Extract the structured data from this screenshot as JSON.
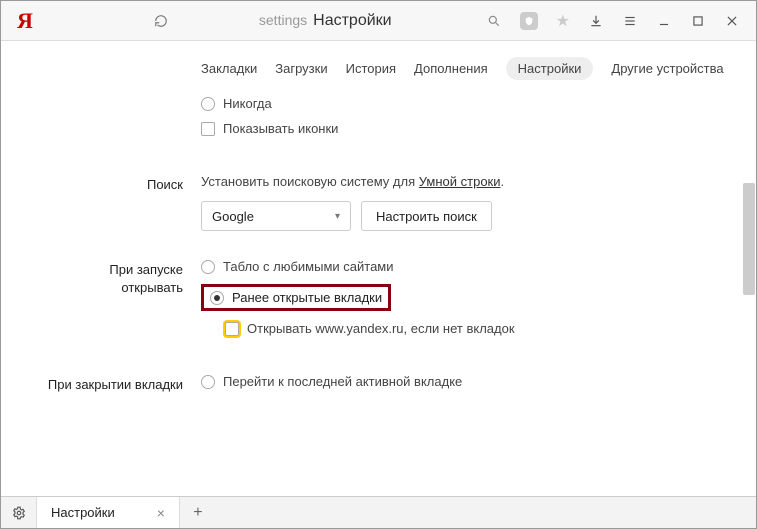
{
  "titlebar": {
    "logo": "Я",
    "url_path": "settings",
    "url_title": "Настройки"
  },
  "nav": {
    "tabs": [
      {
        "label": "Закладки"
      },
      {
        "label": "Загрузки"
      },
      {
        "label": "История"
      },
      {
        "label": "Дополнения"
      },
      {
        "label": "Настройки",
        "active": true
      },
      {
        "label": "Другие устройства"
      }
    ]
  },
  "sections": {
    "top_fragment": {
      "never_label": "Никогда",
      "show_icons_label": "Показывать иконки"
    },
    "search": {
      "title": "Поиск",
      "desc_prefix": "Установить поисковую систему для ",
      "desc_link": "Умной строки",
      "desc_suffix": ".",
      "select_value": "Google",
      "configure_label": "Настроить поиск"
    },
    "on_start": {
      "title_line1": "При запуске",
      "title_line2": "открывать",
      "opt_tablo": "Табло с любимыми сайтами",
      "opt_prev_tabs": "Ранее открытые вкладки",
      "open_yandex": "Открывать www.yandex.ru, если нет вкладок"
    },
    "on_close": {
      "title": "При закрытии вкладки",
      "opt_last_active": "Перейти к последней активной вкладке"
    }
  },
  "bottom": {
    "tab_label": "Настройки"
  }
}
